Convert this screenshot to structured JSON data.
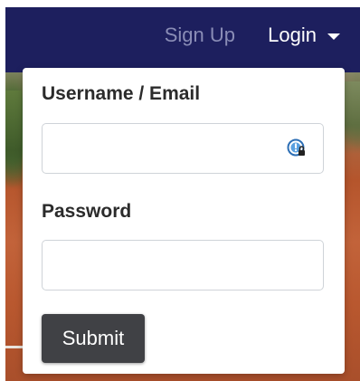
{
  "navbar": {
    "signup_label": "Sign Up",
    "login_label": "Login",
    "background_color": "#1d1f5e"
  },
  "login_form": {
    "username_label": "Username / Email",
    "username_value": "",
    "password_label": "Password",
    "password_value": "",
    "submit_label": "Submit",
    "password_manager_icon": "password-manager-icon"
  }
}
